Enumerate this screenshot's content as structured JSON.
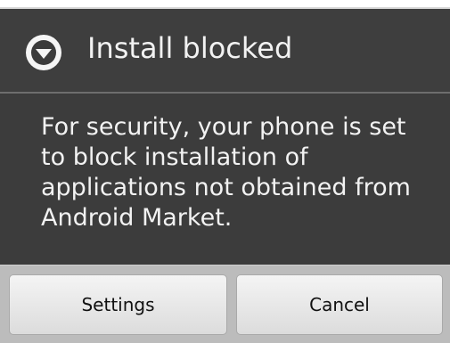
{
  "dialog": {
    "title": "Install blocked",
    "icon": "info-circle-down-icon",
    "message": "For security, your phone is set to block installation of applications not obtained from Android Market."
  },
  "buttons": {
    "settings_label": "Settings",
    "cancel_label": "Cancel"
  },
  "colors": {
    "dialog_background": "#3c3c3c",
    "title_text": "#f2f2f2",
    "button_bar": "#bcbcbc",
    "button_face": "#e8e8e8"
  }
}
